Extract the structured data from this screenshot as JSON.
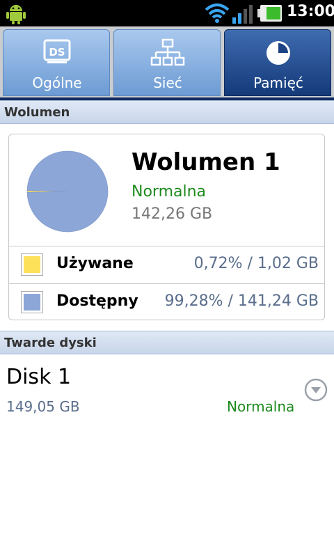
{
  "status_bar": {
    "time": "13:00"
  },
  "tabs": [
    {
      "label": "Ogólne",
      "icon": "ds-icon",
      "active": false
    },
    {
      "label": "Sieć",
      "icon": "network-icon",
      "active": false
    },
    {
      "label": "Pamięć",
      "icon": "pie-clock-icon",
      "active": true
    }
  ],
  "volume_section": {
    "header": "Wolumen",
    "title": "Wolumen 1",
    "status": "Normalna",
    "size": "142,26 GB",
    "rows": [
      {
        "label": "Używane",
        "value": "0,72% / 1,02 GB",
        "color": "#fde15a"
      },
      {
        "label": "Dostępny",
        "value": "99,28% / 141,24 GB",
        "color": "#8da6d8"
      }
    ]
  },
  "chart_data": {
    "type": "pie",
    "categories": [
      "Używane",
      "Dostępny"
    ],
    "values": [
      0.72,
      99.28
    ],
    "colors": [
      "#fde15a",
      "#8da6d8"
    ]
  },
  "disks_section": {
    "header": "Twarde dyski",
    "disks": [
      {
        "name": "Disk 1",
        "size": "149,05 GB",
        "status": "Normalna"
      }
    ]
  },
  "colors": {
    "tab_active": "#143a7a",
    "tab_inactive": "#6c9bd3",
    "status_ok": "#1d8a1d",
    "value_text": "#5a6e8c"
  }
}
